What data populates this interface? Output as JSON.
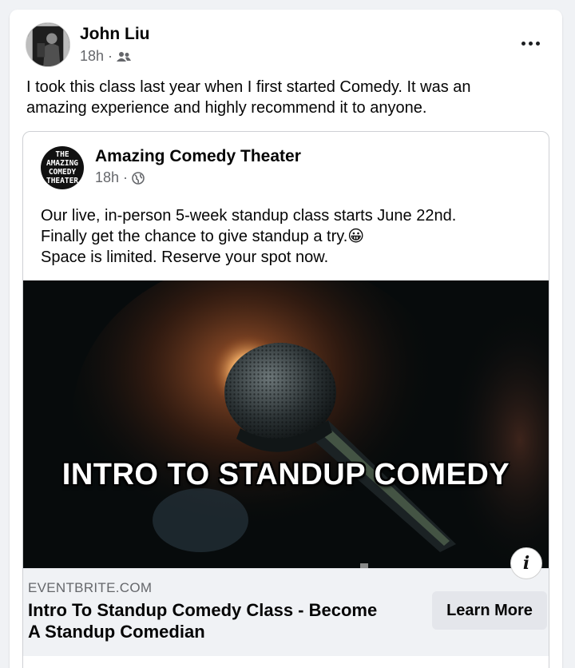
{
  "post": {
    "author": "John Liu",
    "time": "18h",
    "audience_icon": "friends-icon",
    "text_line1": "I took this class last year when I first started Comedy.  It was an",
    "text_line2": "amazing experience and highly recommend it to anyone."
  },
  "shared_post": {
    "page_name": "Amazing Comedy Theater",
    "logo_lines": [
      "THE",
      "AMAZING",
      "COMEDY",
      "THEATER"
    ],
    "time": "18h",
    "audience_icon": "globe-icon",
    "line1": "Our live, in-person 5-week standup class starts June 22nd.",
    "line2": "Finally get the chance to give standup a try.😀",
    "line3": "Space is limited. Reserve your spot now."
  },
  "media": {
    "caption": "INTRO TO STANDUP COMEDY",
    "info_label": "i"
  },
  "link_preview": {
    "domain": "EVENTBRITE.COM",
    "title_line1": "Intro To Standup Comedy Class - Become",
    "title_line2": "A Standup Comedian",
    "cta_label": "Learn More"
  },
  "separator": "·"
}
